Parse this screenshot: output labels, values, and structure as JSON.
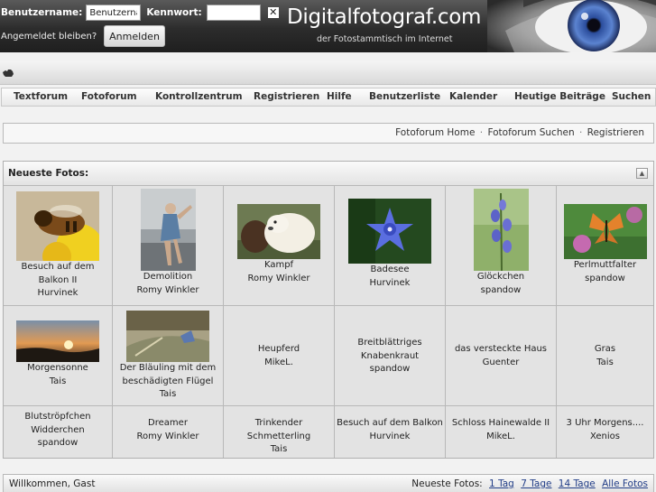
{
  "header": {
    "username_label": "Benutzername:",
    "username_value": "Benutzernan",
    "password_label": "Kennwort:",
    "password_value": "",
    "close_glyph": "✕",
    "remember_label": "Angemeldet bleiben?",
    "login_button": "Anmelden",
    "logo_text": "Digitalfotograf.com",
    "tagline": "der Fotostammtisch im Internet"
  },
  "nav": {
    "items": [
      "Textforum",
      "Fotoforum",
      "Kontrollzentrum",
      "Registrieren",
      "Hilfe",
      "Benutzerliste",
      "Kalender",
      "Heutige Beiträge",
      "Suchen"
    ]
  },
  "breadcrumbs": {
    "home": "Fotoforum Home",
    "search": "Fotoforum Suchen",
    "register": "Registrieren",
    "separator": "·"
  },
  "panel": {
    "title": "Neueste Fotos:",
    "photos": [
      {
        "title": "Besuch auf dem Balkon II",
        "author": "Hurvinek",
        "thumb": "bee-on-flower"
      },
      {
        "title": "Demolition",
        "author": "Romy Winkler",
        "thumb": "woman-portrait"
      },
      {
        "title": "Kampf",
        "author": "Romy Winkler",
        "thumb": "dogs"
      },
      {
        "title": "Badesee",
        "author": "Hurvinek",
        "thumb": "blue-flower"
      },
      {
        "title": "Glöckchen",
        "author": "spandow",
        "thumb": "bluebells"
      },
      {
        "title": "Perlmuttfalter",
        "author": "spandow",
        "thumb": "butterfly"
      },
      {
        "title": "Morgensonne",
        "author": "Tais",
        "thumb": "sunrise"
      },
      {
        "title": "Der Bläuling mit dem beschädigten Flügel",
        "author": "Tais",
        "thumb": "blue-butterfly"
      },
      {
        "title": "Heupferd",
        "author": "MikeL."
      },
      {
        "title": "Breitblättriges Knabenkraut",
        "author": "spandow"
      },
      {
        "title": "das versteckte Haus",
        "author": "Guenter"
      },
      {
        "title": "Gras",
        "author": "Tais"
      },
      {
        "title": "Blutströpfchen Widderchen",
        "author": "spandow"
      },
      {
        "title": "Dreamer",
        "author": "Romy Winkler"
      },
      {
        "title": "Trinkender Schmetterling",
        "author": "Tais"
      },
      {
        "title": "Besuch auf dem Balkon",
        "author": "Hurvinek"
      },
      {
        "title": "Schloss Hainewalde II",
        "author": "MikeL."
      },
      {
        "title": "3 Uhr Morgens....",
        "author": "Xenios"
      }
    ]
  },
  "footer": {
    "welcome": "Willkommen, Gast",
    "newest_label": "Neueste Fotos:",
    "links": [
      "1 Tag",
      "7 Tage",
      "14 Tage",
      "Alle Fotos"
    ]
  },
  "colors": {
    "header_dark": "#2c2c2c",
    "link_blue": "#223e88",
    "panel_bg": "#e3e3e3"
  }
}
